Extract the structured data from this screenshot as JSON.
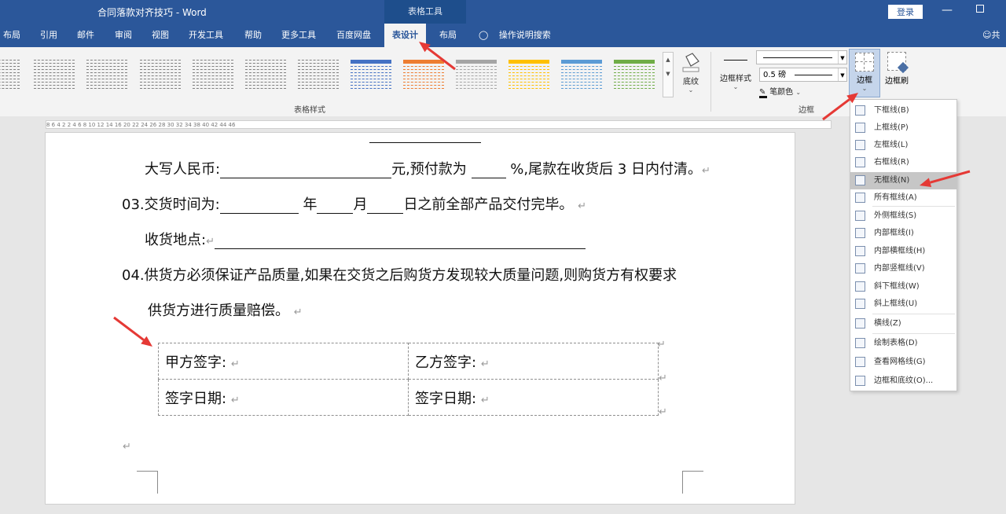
{
  "titlebar": {
    "title": "合同落款对齐技巧  -  Word",
    "context": "表格工具",
    "login": "登录",
    "minimize": "—"
  },
  "tabs": [
    {
      "label": "布局",
      "active": false
    },
    {
      "label": "引用",
      "active": false
    },
    {
      "label": "邮件",
      "active": false
    },
    {
      "label": "审阅",
      "active": false
    },
    {
      "label": "视图",
      "active": false
    },
    {
      "label": "开发工具",
      "active": false
    },
    {
      "label": "帮助",
      "active": false
    },
    {
      "label": "更多工具",
      "active": false
    },
    {
      "label": "百度网盘",
      "active": false
    },
    {
      "label": "表设计",
      "active": true
    },
    {
      "label": "布局",
      "active": false
    }
  ],
  "search": {
    "label": "操作说明搜索",
    "icon": "lightbulb-icon"
  },
  "share": {
    "label": "共",
    "icon": "person-icon"
  },
  "ribbon": {
    "table_styles_label": "表格样式",
    "shading_label": "底纹",
    "border_styles_label": "边框样式",
    "line_weight": "0.5 磅",
    "pen_color_label": "笔颜色",
    "borders_group_label": "边框",
    "borders_button": "边框",
    "border_painter": "边框刷",
    "style_colors": [
      "#7f7f7f",
      "#7f7f7f",
      "#7f7f7f",
      "#7f7f7f",
      "#7f7f7f",
      "#7f7f7f",
      "#7f7f7f",
      "#4472c4",
      "#ed7d31",
      "#a5a5a5",
      "#ffc000",
      "#5b9bd5",
      "#70ad47"
    ]
  },
  "ruler": {
    "text": "8  6  4  2     2  4  6  8  10  12  14  16     20  22  24  26  28  30  32  34     38  40  42  44  46"
  },
  "document": {
    "line1": {
      "a": "大写人民币:",
      "b": "元,预付款为",
      "c": "%,尾款在收货后  3  日内付清。"
    },
    "line2": {
      "a": "03.交货时间为:",
      "b": "年",
      "c": "月",
      "d": "日之前全部产品交付完毕。"
    },
    "line3": {
      "a": "收货地点:"
    },
    "line4": "04.供货方必须保证产品质量,如果在交货之后购货方发现较大质量问题,则购货方有权要求",
    "line5": "供货方进行质量赔偿。",
    "para_mark": "↵",
    "table": [
      [
        "甲方签字:",
        "乙方签字:"
      ],
      [
        "签字日期:",
        "签字日期:"
      ]
    ]
  },
  "borders_menu": [
    {
      "label": "下框线(B)",
      "icon": "bottom-border-icon",
      "highlight": false
    },
    {
      "label": "上框线(P)",
      "icon": "top-border-icon",
      "highlight": false
    },
    {
      "label": "左框线(L)",
      "icon": "left-border-icon",
      "highlight": false
    },
    {
      "label": "右框线(R)",
      "icon": "right-border-icon",
      "highlight": false
    },
    {
      "label": "无框线(N)",
      "icon": "no-border-icon",
      "highlight": true
    },
    {
      "label": "所有框线(A)",
      "icon": "all-borders-icon",
      "highlight": false
    },
    {
      "label": "外侧框线(S)",
      "icon": "outside-borders-icon",
      "highlight": false
    },
    {
      "label": "内部框线(I)",
      "icon": "inside-borders-icon",
      "highlight": false
    },
    {
      "label": "内部横框线(H)",
      "icon": "inside-horizontal-border-icon",
      "highlight": false
    },
    {
      "label": "内部竖框线(V)",
      "icon": "inside-vertical-border-icon",
      "highlight": false
    },
    {
      "label": "斜下框线(W)",
      "icon": "diagonal-down-border-icon",
      "highlight": false
    },
    {
      "label": "斜上框线(U)",
      "icon": "diagonal-up-border-icon",
      "highlight": false
    },
    {
      "label": "横线(Z)",
      "icon": "horizontal-line-icon",
      "highlight": false
    },
    {
      "label": "绘制表格(D)",
      "icon": "draw-table-icon",
      "highlight": false
    },
    {
      "label": "查看网格线(G)",
      "icon": "view-gridlines-icon",
      "highlight": false
    },
    {
      "label": "边框和底纹(O)...",
      "icon": "borders-shading-icon",
      "highlight": false
    }
  ],
  "annotation_color": "#e53935"
}
